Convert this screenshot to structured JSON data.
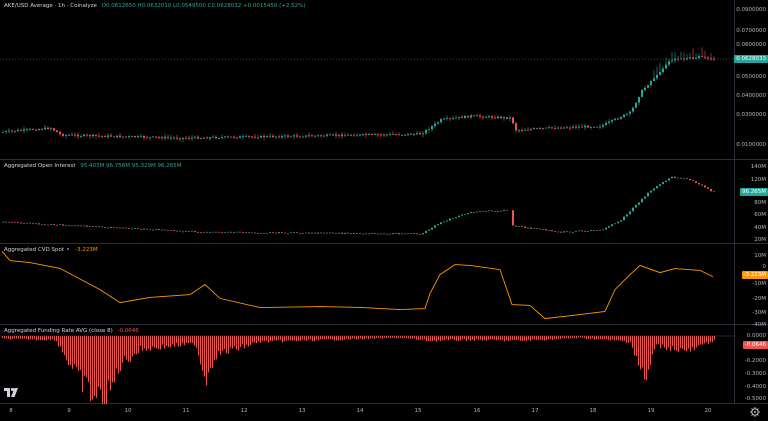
{
  "price_pane": {
    "legend_title": "AKE/USD Average · 1h · Coinalyze",
    "legend_values": "O0.0612650 H0.0632010 L0.0549500 C0.0628032 +0.0015450 (+2.52%)",
    "current_value": "0.0628033",
    "ticks": [
      "0.0900000",
      "0.0700000",
      "0.0600000",
      "0.0500000",
      "0.0400000",
      "0.0300000",
      "0.0200000",
      "0.0100000"
    ],
    "up_color": "#26a69a",
    "down_color": "#ef5350"
  },
  "oi_pane": {
    "legend_title": "Aggregated Open Interest",
    "legend_values": "95.403M 96.756M 95.329M 96.265M",
    "current_value": "96.265M",
    "ticks": [
      "140M",
      "120M",
      "100M",
      "80M",
      "60M",
      "40M",
      "20M"
    ]
  },
  "cvd_pane": {
    "legend_title": "Aggregated CVD Spot ⚬",
    "legend_values": "-3.223M",
    "current_value": "-3.223M",
    "ticks": [
      "10M",
      "0",
      "-10M",
      "-20M",
      "-30M",
      "-40M"
    ],
    "line_color": "#ff9800"
  },
  "funding_pane": {
    "legend_title": "Aggregated Funding Rate AVG (close 8)",
    "legend_values": "-0.0646",
    "current_value": "-0.0646",
    "ticks": [
      "0.0000",
      "-0.1000",
      "-0.2000",
      "-0.3000",
      "-0.4000",
      "-0.5000"
    ],
    "bar_color": "#ef5350"
  },
  "x_axis": {
    "labels": [
      "8",
      "9",
      "10",
      "11",
      "12",
      "13",
      "14",
      "15",
      "16",
      "17",
      "18",
      "19",
      "20"
    ]
  },
  "logo_icon": "tradingview-logo-icon",
  "settings_icon": "gear-icon"
}
